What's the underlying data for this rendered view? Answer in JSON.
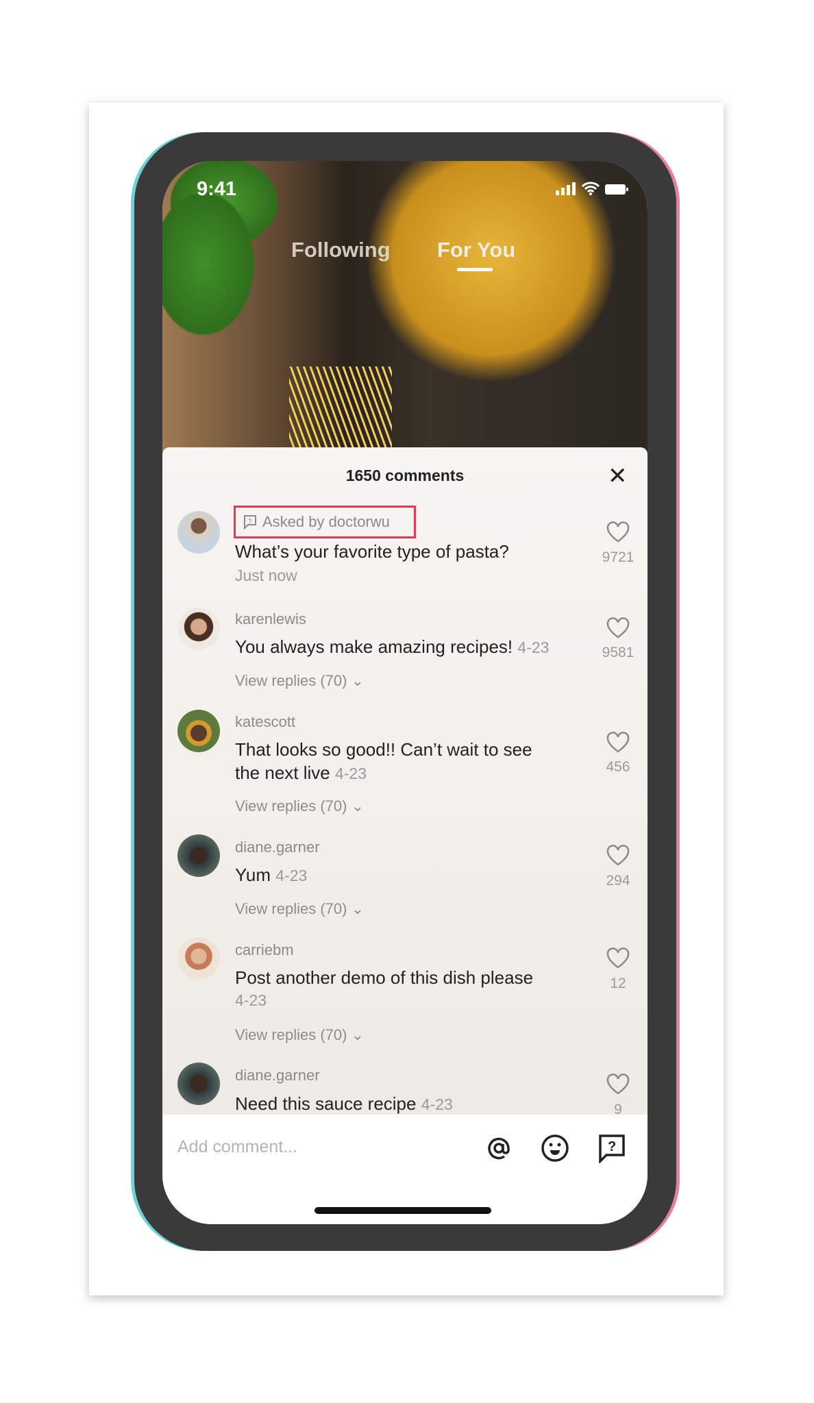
{
  "status": {
    "time": "9:41"
  },
  "tabs": [
    {
      "label": "Following",
      "active": false
    },
    {
      "label": "For You",
      "active": true
    }
  ],
  "comments_header": {
    "title": "1650 comments",
    "close_icon": "close-icon"
  },
  "question": {
    "label": "Asked by doctorwu",
    "text": "What’s your favorite type of pasta?",
    "time": "Just now",
    "likes": "9721",
    "highlight_color": "#e53950"
  },
  "comments": [
    {
      "user": "karenlewis",
      "text": "You always make amazing recipes!",
      "date": "4-23",
      "replies": "View replies (70)",
      "likes": "9581"
    },
    {
      "user": "katescott",
      "text": "That looks so good!! Can’t wait to see",
      "text2": "the next live",
      "date": "4-23",
      "replies": "View replies (70)",
      "likes": "456"
    },
    {
      "user": "diane.garner",
      "text": "Yum",
      "date": "4-23",
      "replies": "View replies (70)",
      "likes": "294"
    },
    {
      "user": "carriebm",
      "text": "Post another demo of this dish please",
      "date": "4-23",
      "replies": "View replies (70)",
      "likes": "12"
    },
    {
      "user": "diane.garner",
      "text": "Need this sauce recipe",
      "date": "4-23",
      "likes": "9"
    }
  ],
  "composer": {
    "placeholder": "Add comment...",
    "icons": [
      "at-icon",
      "emoji-icon",
      "question-icon"
    ]
  }
}
